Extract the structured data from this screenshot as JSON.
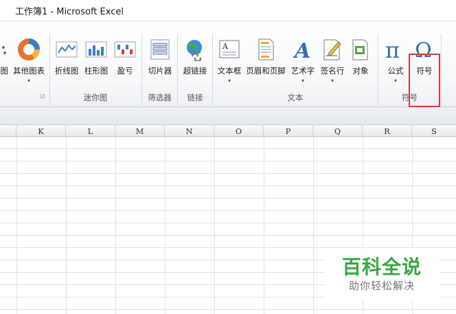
{
  "window": {
    "title": "工作簿1  -  Microsoft Excel"
  },
  "ribbon": {
    "buttons": {
      "chart_partial": "图",
      "other_charts": "其他图表",
      "sparkline_line": "折线图",
      "sparkline_column": "柱形图",
      "sparkline_winloss": "盈亏",
      "slicer": "切片器",
      "hyperlink": "超链接",
      "textbox": "文本框",
      "header_footer": "页眉和页脚",
      "wordart": "艺术字",
      "signature_line": "签名行",
      "object": "对象",
      "equation": "公式",
      "symbol": "符号"
    },
    "groups": {
      "sparklines": "迷你图",
      "filter": "筛选器",
      "links": "链接",
      "text": "文本",
      "symbols": "符号"
    },
    "dropdown_glyph": "▾",
    "highlight_color": "#d63a3a"
  },
  "sheet": {
    "columns": [
      "K",
      "L",
      "M",
      "N",
      "O",
      "P",
      "Q",
      "R",
      "S"
    ]
  },
  "watermark": {
    "title": "百科全说",
    "subtitle": "助你轻松解决"
  }
}
